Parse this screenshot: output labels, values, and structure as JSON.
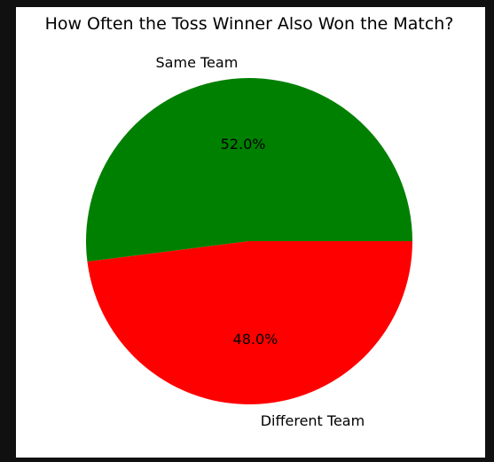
{
  "chart_data": {
    "type": "pie",
    "title": "How Often the Toss Winner Also Won the Match?",
    "categories": [
      "Same Team",
      "Different Team"
    ],
    "values": [
      52.0,
      48.0
    ],
    "percent_labels": [
      "52.0%",
      "48.0%"
    ],
    "colors": [
      "#008000",
      "#ff0000"
    ],
    "start_angle_deg": 0,
    "direction": "counterclockwise",
    "legend": "none"
  }
}
